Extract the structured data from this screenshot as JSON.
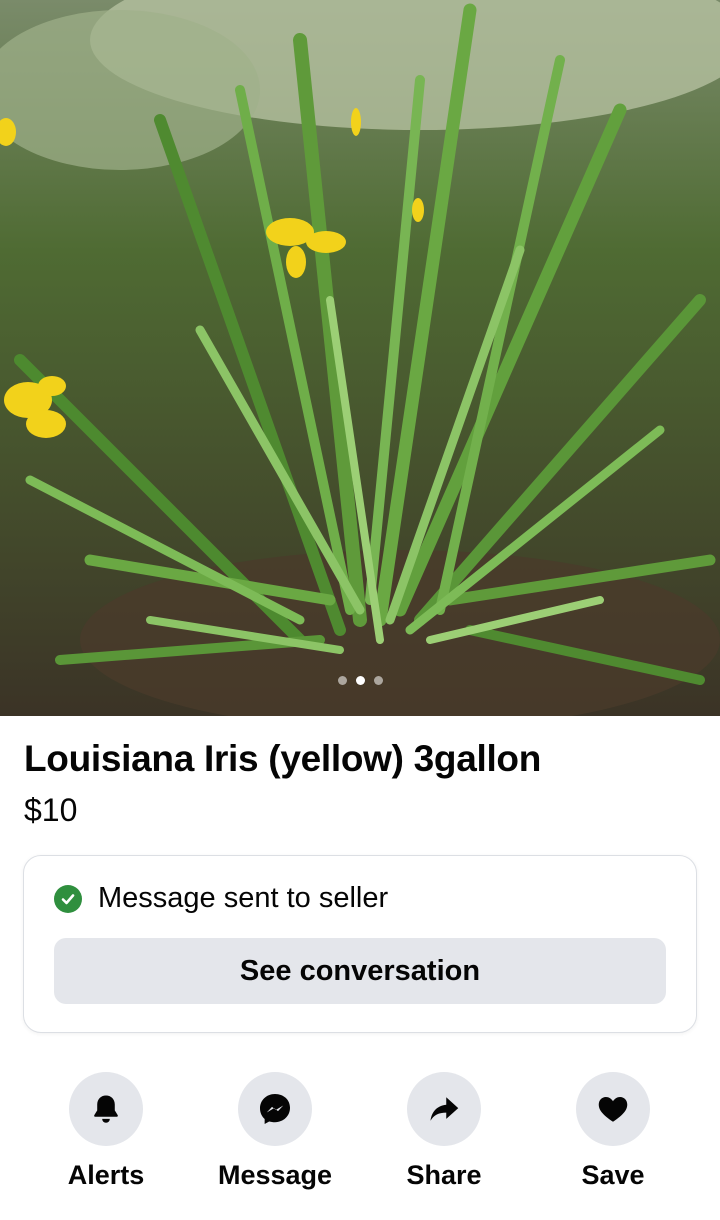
{
  "listing": {
    "title": "Louisiana Iris (yellow) 3gallon",
    "price": "$10",
    "photo": {
      "subject": "yellow iris plant in pot",
      "dots": 3,
      "active_dot": 2
    }
  },
  "status": {
    "icon": "check-circle-icon",
    "text": "Message sent to seller",
    "button_label": "See conversation",
    "accent": "#2f8f3e"
  },
  "actions": [
    {
      "label": "Alerts",
      "icon": "bell-icon"
    },
    {
      "label": "Message",
      "icon": "messenger-icon"
    },
    {
      "label": "Share",
      "icon": "share-arrow-icon"
    },
    {
      "label": "Save",
      "icon": "heart-icon"
    }
  ],
  "colors": {
    "button_bg": "#e4e6eb",
    "text": "#050505"
  }
}
